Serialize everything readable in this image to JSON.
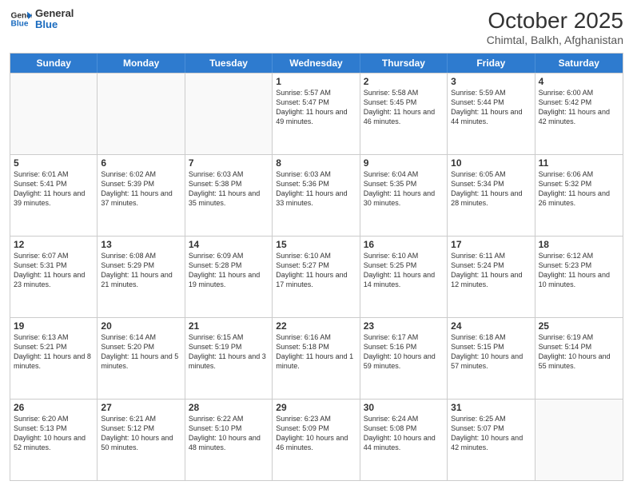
{
  "header": {
    "logo_general": "General",
    "logo_blue": "Blue",
    "month": "October 2025",
    "location": "Chimtal, Balkh, Afghanistan"
  },
  "weekdays": [
    "Sunday",
    "Monday",
    "Tuesday",
    "Wednesday",
    "Thursday",
    "Friday",
    "Saturday"
  ],
  "rows": [
    [
      {
        "day": "",
        "empty": true
      },
      {
        "day": "",
        "empty": true
      },
      {
        "day": "",
        "empty": true
      },
      {
        "day": "1",
        "sunrise": "5:57 AM",
        "sunset": "5:47 PM",
        "daylight": "11 hours and 49 minutes."
      },
      {
        "day": "2",
        "sunrise": "5:58 AM",
        "sunset": "5:45 PM",
        "daylight": "11 hours and 46 minutes."
      },
      {
        "day": "3",
        "sunrise": "5:59 AM",
        "sunset": "5:44 PM",
        "daylight": "11 hours and 44 minutes."
      },
      {
        "day": "4",
        "sunrise": "6:00 AM",
        "sunset": "5:42 PM",
        "daylight": "11 hours and 42 minutes."
      }
    ],
    [
      {
        "day": "5",
        "sunrise": "6:01 AM",
        "sunset": "5:41 PM",
        "daylight": "11 hours and 39 minutes."
      },
      {
        "day": "6",
        "sunrise": "6:02 AM",
        "sunset": "5:39 PM",
        "daylight": "11 hours and 37 minutes."
      },
      {
        "day": "7",
        "sunrise": "6:03 AM",
        "sunset": "5:38 PM",
        "daylight": "11 hours and 35 minutes."
      },
      {
        "day": "8",
        "sunrise": "6:03 AM",
        "sunset": "5:36 PM",
        "daylight": "11 hours and 33 minutes."
      },
      {
        "day": "9",
        "sunrise": "6:04 AM",
        "sunset": "5:35 PM",
        "daylight": "11 hours and 30 minutes."
      },
      {
        "day": "10",
        "sunrise": "6:05 AM",
        "sunset": "5:34 PM",
        "daylight": "11 hours and 28 minutes."
      },
      {
        "day": "11",
        "sunrise": "6:06 AM",
        "sunset": "5:32 PM",
        "daylight": "11 hours and 26 minutes."
      }
    ],
    [
      {
        "day": "12",
        "sunrise": "6:07 AM",
        "sunset": "5:31 PM",
        "daylight": "11 hours and 23 minutes."
      },
      {
        "day": "13",
        "sunrise": "6:08 AM",
        "sunset": "5:29 PM",
        "daylight": "11 hours and 21 minutes."
      },
      {
        "day": "14",
        "sunrise": "6:09 AM",
        "sunset": "5:28 PM",
        "daylight": "11 hours and 19 minutes."
      },
      {
        "day": "15",
        "sunrise": "6:10 AM",
        "sunset": "5:27 PM",
        "daylight": "11 hours and 17 minutes."
      },
      {
        "day": "16",
        "sunrise": "6:10 AM",
        "sunset": "5:25 PM",
        "daylight": "11 hours and 14 minutes."
      },
      {
        "day": "17",
        "sunrise": "6:11 AM",
        "sunset": "5:24 PM",
        "daylight": "11 hours and 12 minutes."
      },
      {
        "day": "18",
        "sunrise": "6:12 AM",
        "sunset": "5:23 PM",
        "daylight": "11 hours and 10 minutes."
      }
    ],
    [
      {
        "day": "19",
        "sunrise": "6:13 AM",
        "sunset": "5:21 PM",
        "daylight": "11 hours and 8 minutes."
      },
      {
        "day": "20",
        "sunrise": "6:14 AM",
        "sunset": "5:20 PM",
        "daylight": "11 hours and 5 minutes."
      },
      {
        "day": "21",
        "sunrise": "6:15 AM",
        "sunset": "5:19 PM",
        "daylight": "11 hours and 3 minutes."
      },
      {
        "day": "22",
        "sunrise": "6:16 AM",
        "sunset": "5:18 PM",
        "daylight": "11 hours and 1 minute."
      },
      {
        "day": "23",
        "sunrise": "6:17 AM",
        "sunset": "5:16 PM",
        "daylight": "10 hours and 59 minutes."
      },
      {
        "day": "24",
        "sunrise": "6:18 AM",
        "sunset": "5:15 PM",
        "daylight": "10 hours and 57 minutes."
      },
      {
        "day": "25",
        "sunrise": "6:19 AM",
        "sunset": "5:14 PM",
        "daylight": "10 hours and 55 minutes."
      }
    ],
    [
      {
        "day": "26",
        "sunrise": "6:20 AM",
        "sunset": "5:13 PM",
        "daylight": "10 hours and 52 minutes."
      },
      {
        "day": "27",
        "sunrise": "6:21 AM",
        "sunset": "5:12 PM",
        "daylight": "10 hours and 50 minutes."
      },
      {
        "day": "28",
        "sunrise": "6:22 AM",
        "sunset": "5:10 PM",
        "daylight": "10 hours and 48 minutes."
      },
      {
        "day": "29",
        "sunrise": "6:23 AM",
        "sunset": "5:09 PM",
        "daylight": "10 hours and 46 minutes."
      },
      {
        "day": "30",
        "sunrise": "6:24 AM",
        "sunset": "5:08 PM",
        "daylight": "10 hours and 44 minutes."
      },
      {
        "day": "31",
        "sunrise": "6:25 AM",
        "sunset": "5:07 PM",
        "daylight": "10 hours and 42 minutes."
      },
      {
        "day": "",
        "empty": true
      }
    ]
  ]
}
